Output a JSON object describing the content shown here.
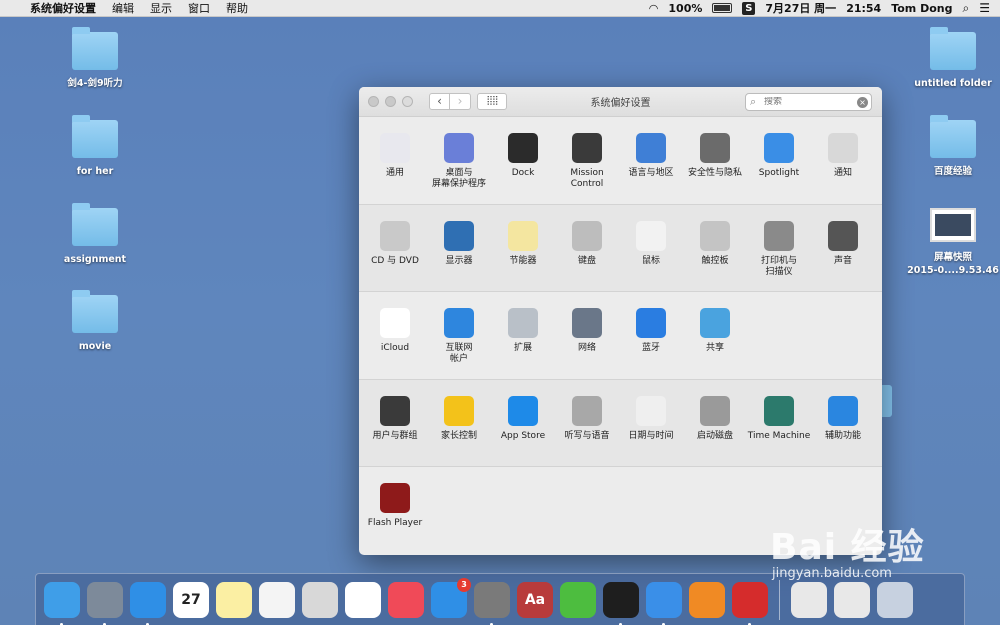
{
  "menubar": {
    "app_name": "系统偏好设置",
    "menus": [
      "编辑",
      "显示",
      "窗口",
      "帮助"
    ],
    "battery": "100%",
    "date": "7月27日 周一",
    "time": "21:54",
    "user": "Tom Dong"
  },
  "desktop": {
    "left": [
      "剑4-剑9听力",
      "for her",
      "assignment",
      "movie"
    ],
    "right": [
      "untitled folder",
      "百度经验"
    ],
    "screenshot_label_1": "屏幕快照",
    "screenshot_label_2": "2015-0....9.53.46"
  },
  "window": {
    "title": "系统偏好设置",
    "search_placeholder": "搜索",
    "rows": [
      [
        {
          "label": "通用",
          "icon": "general-icon",
          "color": "#e8e8ee"
        },
        {
          "label": "桌面与\n屏幕保护程序",
          "icon": "desktop-icon",
          "color": "#6a7fd8"
        },
        {
          "label": "Dock",
          "icon": "dock-icon",
          "color": "#2b2b2b"
        },
        {
          "label": "Mission\nControl",
          "icon": "mission-control-icon",
          "color": "#3a3a3a"
        },
        {
          "label": "语言与地区",
          "icon": "language-icon",
          "color": "#3f7fd6"
        },
        {
          "label": "安全性与隐私",
          "icon": "security-icon",
          "color": "#6b6b6b"
        },
        {
          "label": "Spotlight",
          "icon": "spotlight-icon",
          "color": "#3a8ee6"
        },
        {
          "label": "通知",
          "icon": "notifications-icon",
          "color": "#d8d8d8"
        }
      ],
      [
        {
          "label": "CD 与 DVD",
          "icon": "cd-dvd-icon",
          "color": "#c9c9c9"
        },
        {
          "label": "显示器",
          "icon": "display-icon",
          "color": "#2f6fb3"
        },
        {
          "label": "节能器",
          "icon": "energy-icon",
          "color": "#f4e6a0"
        },
        {
          "label": "键盘",
          "icon": "keyboard-icon",
          "color": "#bdbdbd"
        },
        {
          "label": "鼠标",
          "icon": "mouse-icon",
          "color": "#f2f2f2"
        },
        {
          "label": "触控板",
          "icon": "trackpad-icon",
          "color": "#c4c4c4"
        },
        {
          "label": "打印机与\n扫描仪",
          "icon": "printer-icon",
          "color": "#8a8a8a"
        },
        {
          "label": "声音",
          "icon": "sound-icon",
          "color": "#555555"
        }
      ],
      [
        {
          "label": "iCloud",
          "icon": "icloud-icon",
          "color": "#ffffff"
        },
        {
          "label": "互联网\n帐户",
          "icon": "internet-accounts-icon",
          "color": "#2e86de"
        },
        {
          "label": "扩展",
          "icon": "extensions-icon",
          "color": "#b9c0c8"
        },
        {
          "label": "网络",
          "icon": "network-icon",
          "color": "#6a7789"
        },
        {
          "label": "蓝牙",
          "icon": "bluetooth-icon",
          "color": "#2a7de1"
        },
        {
          "label": "共享",
          "icon": "sharing-icon",
          "color": "#4aa3df"
        }
      ],
      [
        {
          "label": "用户与群组",
          "icon": "users-icon",
          "color": "#3a3a3a"
        },
        {
          "label": "家长控制",
          "icon": "parental-icon",
          "color": "#f3c21a"
        },
        {
          "label": "App Store",
          "icon": "app-store-icon",
          "color": "#1e8ae8"
        },
        {
          "label": "听写与语音",
          "icon": "dictation-icon",
          "color": "#a8a8a8"
        },
        {
          "label": "日期与时间",
          "icon": "date-time-icon",
          "color": "#efefef"
        },
        {
          "label": "启动磁盘",
          "icon": "startup-disk-icon",
          "color": "#9a9a9a"
        },
        {
          "label": "Time Machine",
          "icon": "time-machine-icon",
          "color": "#2c7a6c"
        },
        {
          "label": "辅助功能",
          "icon": "accessibility-icon",
          "color": "#2a86e0"
        }
      ],
      [
        {
          "label": "Flash Player",
          "icon": "flash-icon",
          "color": "#8e1a1a"
        }
      ]
    ]
  },
  "dock": {
    "items": [
      {
        "name": "finder-icon",
        "color": "#3f9ee8"
      },
      {
        "name": "launchpad-icon",
        "color": "#7d8a9a"
      },
      {
        "name": "safari-icon",
        "color": "#2f8fe6"
      },
      {
        "name": "calendar-icon",
        "color": "#ffffff",
        "text": "27"
      },
      {
        "name": "notes-icon",
        "color": "#fbefa3"
      },
      {
        "name": "reminders-icon",
        "color": "#f4f4f4"
      },
      {
        "name": "preview-icon",
        "color": "#d8d8d8"
      },
      {
        "name": "photos-icon",
        "color": "#ffffff"
      },
      {
        "name": "itunes-icon",
        "color": "#f04a58"
      },
      {
        "name": "app-store-icon",
        "color": "#2f8fe6",
        "badge": "3"
      },
      {
        "name": "system-preferences-icon",
        "color": "#7a7a7a"
      },
      {
        "name": "dictionary-icon",
        "color": "#b83b3b",
        "text": "Aa"
      },
      {
        "name": "qq-music-icon",
        "color": "#4dbd3f"
      },
      {
        "name": "qq-icon",
        "color": "#1e1e1e"
      },
      {
        "name": "baidu-cloud-icon",
        "color": "#3a8fe8"
      },
      {
        "name": "thunder-icon",
        "color": "#f08a24"
      },
      {
        "name": "weibo-icon",
        "color": "#d52c2c"
      }
    ],
    "calendar_month": "7月"
  },
  "watermark": {
    "main": "Bai 经验",
    "sub": "jingyan.baidu.com"
  }
}
